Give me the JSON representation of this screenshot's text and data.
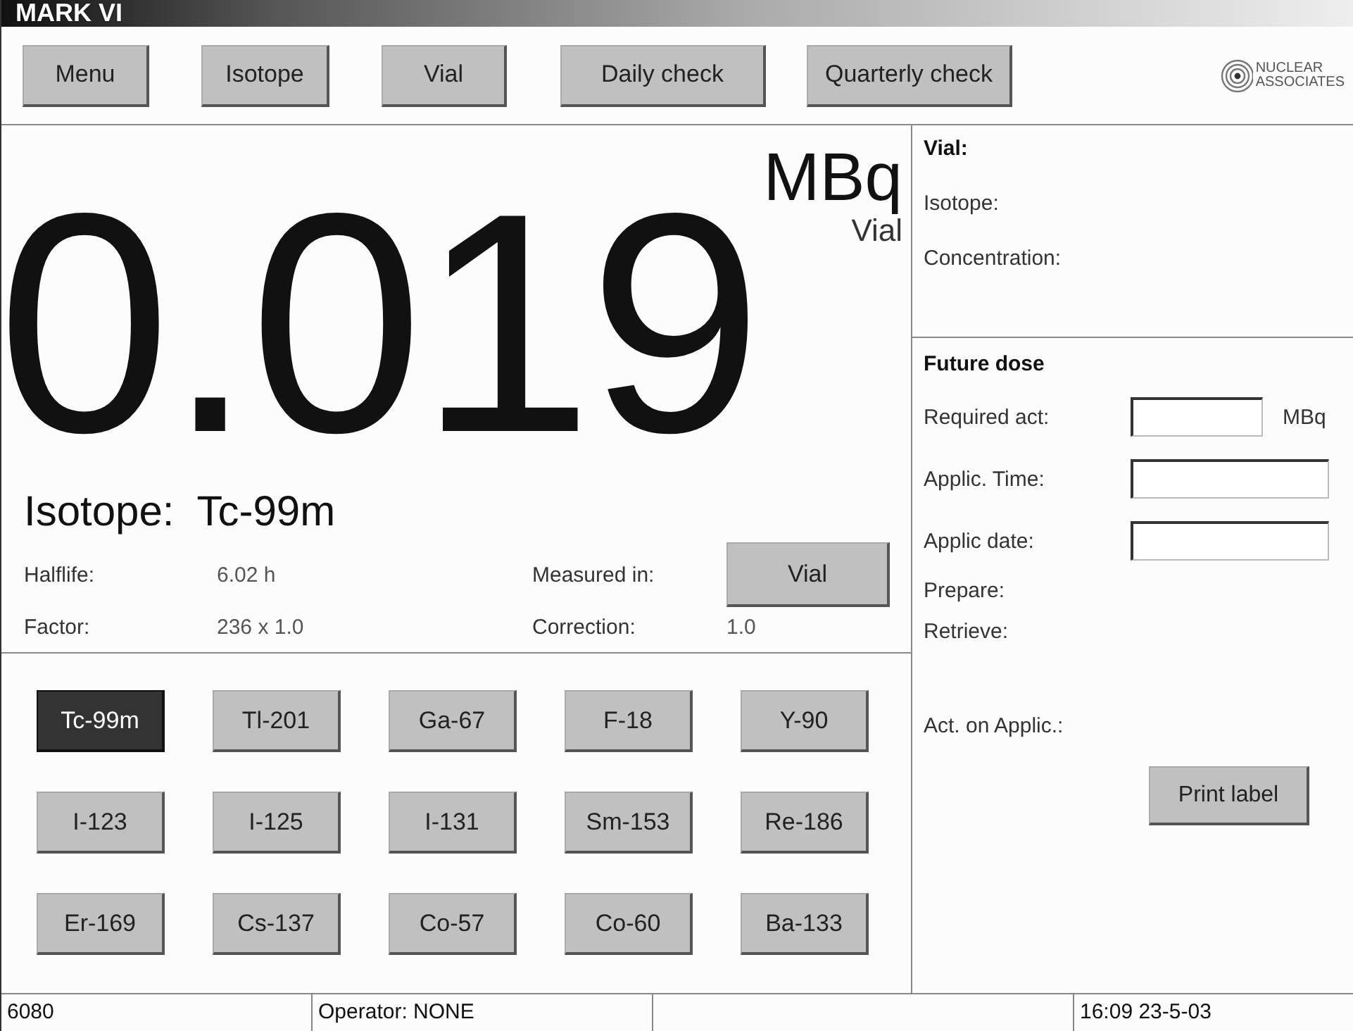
{
  "window": {
    "title": "MARK VI"
  },
  "toolbar": {
    "buttons": [
      "Menu",
      "Isotope",
      "Vial",
      "Daily check",
      "Quarterly check"
    ],
    "logo": [
      "NUCLEAR",
      "ASSOCIATES"
    ]
  },
  "reading": {
    "value": "0.019",
    "unit": "MBq",
    "measured": "Vial"
  },
  "isotope": {
    "label": "Isotope:",
    "name": "Tc-99m",
    "halflife_label": "Halflife:",
    "halflife": "6.02 h",
    "factor_label": "Factor:",
    "factor": "236 x 1.0",
    "measured_label": "Measured in:",
    "measured_button": "Vial",
    "correction_label": "Correction:",
    "correction": "1.0"
  },
  "isotope_buttons": [
    {
      "label": "Tc-99m",
      "selected": true
    },
    {
      "label": "Tl-201",
      "selected": false
    },
    {
      "label": "Ga-67",
      "selected": false
    },
    {
      "label": "F-18",
      "selected": false
    },
    {
      "label": "Y-90",
      "selected": false
    },
    {
      "label": "I-123",
      "selected": false
    },
    {
      "label": "I-125",
      "selected": false
    },
    {
      "label": "I-131",
      "selected": false
    },
    {
      "label": "Sm-153",
      "selected": false
    },
    {
      "label": "Re-186",
      "selected": false
    },
    {
      "label": "Er-169",
      "selected": false
    },
    {
      "label": "Cs-137",
      "selected": false
    },
    {
      "label": "Co-57",
      "selected": false
    },
    {
      "label": "Co-60",
      "selected": false
    },
    {
      "label": "Ba-133",
      "selected": false
    }
  ],
  "vial_panel": {
    "title": "Vial:",
    "lines": [
      "Isotope:",
      "Concentration:"
    ]
  },
  "future_dose": {
    "title": "Future dose",
    "fields": [
      {
        "label": "Required act:",
        "unit": "MBq"
      },
      {
        "label": "Applic. Time:"
      },
      {
        "label": "Applic date:"
      }
    ],
    "lines": [
      "Prepare:",
      "Retrieve:"
    ],
    "act_label": "Act. on Applic.:",
    "print_button": "Print label"
  },
  "status_bar": {
    "cells": [
      "6080",
      "Operator: NONE"
    ],
    "clock": "16:09 23-5-03"
  }
}
